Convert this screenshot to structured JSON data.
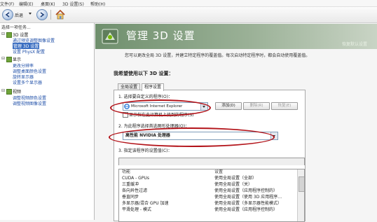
{
  "menu": [
    "文件(F)",
    "编辑(E)",
    "桌面(K)",
    "3D 设置(S)",
    "帮助(H)"
  ],
  "toolbar": {
    "back_label": "后退"
  },
  "tree": {
    "heading": "选择一项任务...",
    "items": [
      {
        "label": "3D 设置",
        "kind": "category"
      },
      {
        "label": "通过预览调整图像设置",
        "kind": "child"
      },
      {
        "label": "管理 3D 设置",
        "kind": "child",
        "selected": true
      },
      {
        "label": "设置 PhysX 配置",
        "kind": "child"
      },
      {
        "label": "显示",
        "kind": "category"
      },
      {
        "label": "更改分辨率",
        "kind": "child"
      },
      {
        "label": "调整桌面颜色设置",
        "kind": "child"
      },
      {
        "label": "旋转显示器",
        "kind": "child"
      },
      {
        "label": "设置多个显示器",
        "kind": "child"
      },
      {
        "label": "视频",
        "kind": "category"
      },
      {
        "label": "调整视频颜色设置",
        "kind": "child"
      },
      {
        "label": "调整视频图像设置",
        "kind": "child"
      }
    ]
  },
  "header": {
    "title": "管理 3D 设置",
    "restore": "恢复默认设置"
  },
  "main": {
    "description": "您可以更改全局 3D 设置，并建立特定程序的覆盖值。每次启动特定程序时，都会自动使用覆盖值。",
    "prompt": "我希望使用以下 3D 设置：",
    "tabs": [
      "全局设置",
      "程序设置"
    ],
    "step1": "1. 选择要自定义的程序(O)：",
    "program_value": "Microsoft Internet Explorer",
    "add_button": "添加(D)",
    "remove_button": "删除(R)",
    "restore_button": "恢复(E)",
    "show_only_label": "显示仅在此计算机上找到的程序(S)",
    "step2": "2. 为此程序选择首选图形处理器(O)：",
    "gpu_value": "高性能 NVIDIA 处理器",
    "step3": "3. 指定该程序的设置值(C)："
  },
  "table": {
    "headers": [
      "功能",
      "设置"
    ],
    "rows": [
      [
        "CUDA - GPUs",
        "使用全局设置（全部）"
      ],
      [
        "三重缓冲",
        "使用全局设置（关）"
      ],
      [
        "各向异性过滤",
        "使用全局设置（应用程序控制的）"
      ],
      [
        "垂直同步",
        "使用全局设置（使用 3D 应用程序…"
      ],
      [
        "多显示器/混合 GPU 加速",
        "使用全局设置（多显示器性能模式）"
      ],
      [
        "平滑处理 - 模式",
        "使用全局设置（应用程序控制的）"
      ]
    ]
  },
  "colors": {
    "accent": "#3b6fc2",
    "highlight_oval": "#b3141a",
    "header_band": "#8aa386"
  }
}
